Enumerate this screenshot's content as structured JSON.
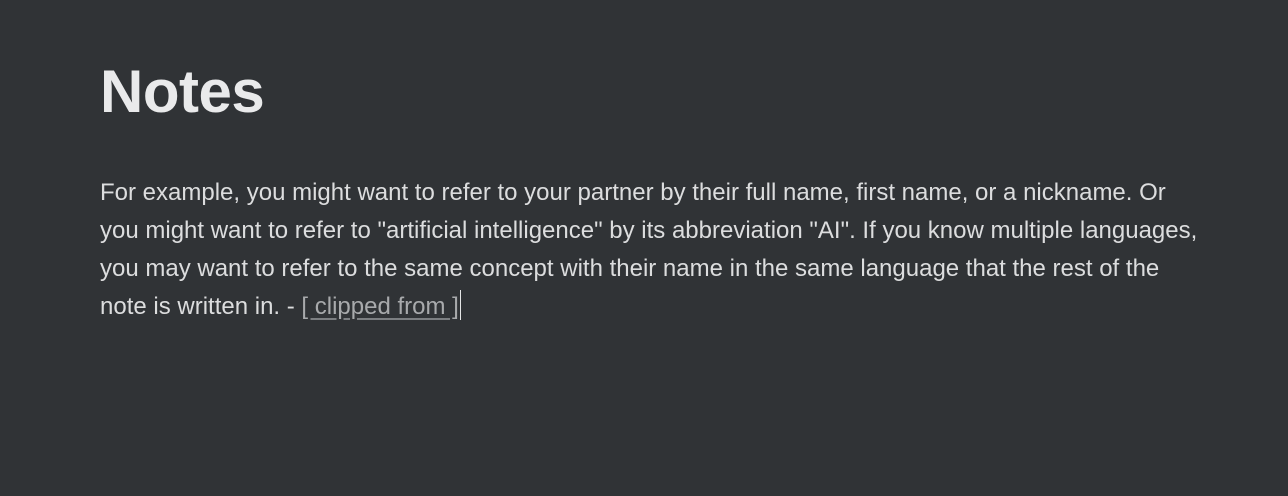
{
  "note": {
    "title": "Notes",
    "body_text": "For example, you might want to refer to your partner by their full name, first name, or a nickname. Or you might want to refer to \"artificial intelligence\" by its abbreviation \"AI\". If you know multiple languages, you may want to refer to the same concept with their name in the same language that the rest of the note is written in. - ",
    "clip_link_label": "[ clipped from ]"
  },
  "colors": {
    "background": "#303336",
    "text": "#dcddde",
    "title": "#e9eaeb",
    "link": "#a8aaac"
  }
}
